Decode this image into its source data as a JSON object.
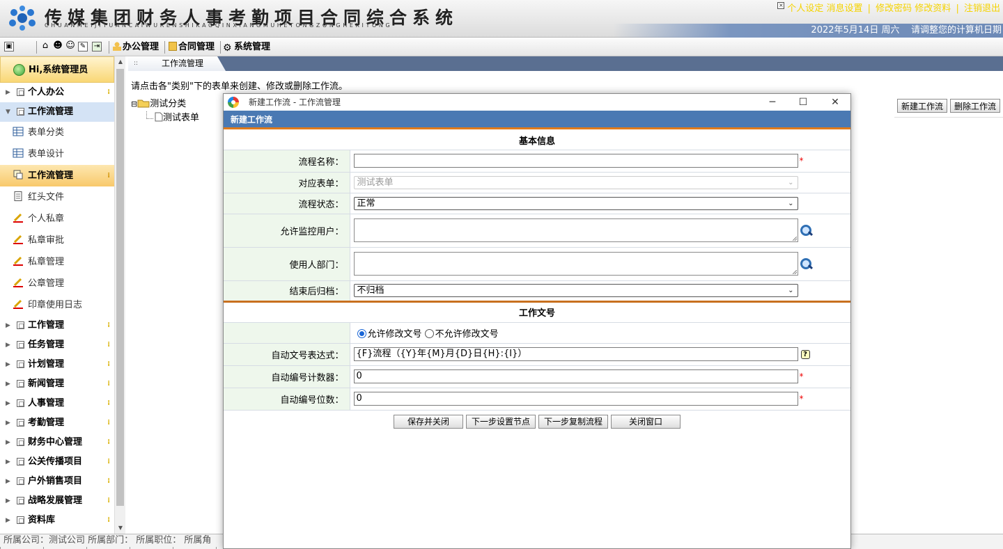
{
  "header": {
    "title": "传媒集团财务人事考勤项目合同综合系统",
    "title_pinyin": "CHUANMEIJITUANCAIWURENSHIKAOQINXIANGMUHETONGZONGHEXITONG",
    "links": [
      "个人设定",
      "消息设置",
      "修改密码",
      "修改资料",
      "注销退出"
    ],
    "link_sep": "|",
    "close_glyph": "×",
    "date_text": "2022年5月14日 周六",
    "date_hint": "请调整您的计算机日期"
  },
  "toolbar": {
    "menus": [
      "办公管理",
      "合同管理",
      "系统管理"
    ]
  },
  "sidebar": {
    "greeting": "Hi,系统管理员",
    "top_items": [
      {
        "label": "个人办公"
      },
      {
        "label": "工作流管理"
      }
    ],
    "sub_items": [
      {
        "label": "表单分类"
      },
      {
        "label": "表单设计"
      },
      {
        "label": "工作流管理"
      },
      {
        "label": "红头文件"
      },
      {
        "label": "个人私章"
      },
      {
        "label": "私章审批"
      },
      {
        "label": "私章管理"
      },
      {
        "label": "公章管理"
      },
      {
        "label": "印章使用日志"
      }
    ],
    "bottom_items": [
      {
        "label": "工作管理"
      },
      {
        "label": "任务管理"
      },
      {
        "label": "计划管理"
      },
      {
        "label": "新闻管理"
      },
      {
        "label": "人事管理"
      },
      {
        "label": "考勤管理"
      },
      {
        "label": "财务中心管理"
      },
      {
        "label": "公关传播项目"
      },
      {
        "label": "户外销售项目"
      },
      {
        "label": "战略发展管理"
      },
      {
        "label": "资料库"
      }
    ]
  },
  "tab": {
    "label": "工作流管理"
  },
  "main": {
    "hint": "请点击各\"类别\"下的表单来创建、修改或删除工作流。",
    "tree": {
      "folder": "测试分类",
      "leaf": "测试表单",
      "expander": "⊟"
    },
    "new_flow_button": "新建工作流",
    "delete_flow_button": "删除工作流"
  },
  "statusbar": {
    "text": "所属公司：测试公司   所属部门：   所属职位：   所属角"
  },
  "dialog": {
    "title": "新建工作流 - 工作流管理",
    "header": "新建工作流",
    "section_basic": "基本信息",
    "section_doc": "工作文号",
    "fields": {
      "flow_name": {
        "label": "流程名称：",
        "value": ""
      },
      "form": {
        "label": "对应表单：",
        "value": "测试表单"
      },
      "status": {
        "label": "流程状态：",
        "value": "正常"
      },
      "monitor_users": {
        "label": "允许监控用户："
      },
      "user_dept": {
        "label": "使用人部门："
      },
      "archive": {
        "label": "结束后归档：",
        "value": "不归档"
      },
      "expr": {
        "label": "自动文号表达式：",
        "value": "{F}流程（{Y}年{M}月{D}日{H}:{I}）"
      },
      "counter": {
        "label": "自动编号计数器：",
        "value": "0"
      },
      "digits": {
        "label": "自动编号位数：",
        "value": "0"
      }
    },
    "radio_allow": "允许修改文号",
    "radio_deny": "不允许修改文号",
    "required_mark": "*",
    "help_glyph": "?",
    "buttons": {
      "save_close": "保存并关闭",
      "next_nodes": "下一步设置节点",
      "next_copy": "下一步复制流程",
      "close": "关闭窗口"
    }
  },
  "colors": {
    "dialog_header": "#4a79b3",
    "section_line": "#c8701e",
    "top_link": "#f5d300",
    "label_bg": "#eef7ec",
    "active_menu": "#f8c96b"
  }
}
